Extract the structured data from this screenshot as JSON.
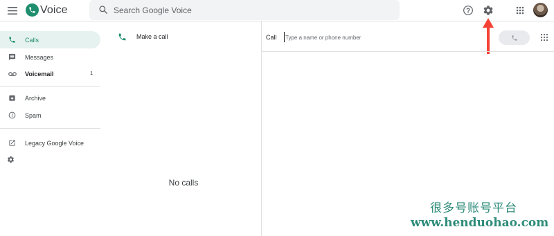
{
  "header": {
    "app_title": "Voice",
    "search_placeholder": "Search Google Voice",
    "icons": [
      "menu-icon",
      "voice-logo-icon",
      "search-icon",
      "help-icon",
      "settings-icon",
      "apps-grid-icon",
      "avatar"
    ]
  },
  "sidebar": {
    "items": [
      {
        "label": "Calls",
        "icon": "phone-icon",
        "active": true
      },
      {
        "label": "Messages",
        "icon": "message-icon"
      },
      {
        "label": "Voicemail",
        "icon": "voicemail-icon",
        "count": "1",
        "bold": true
      },
      {
        "label": "Archive",
        "icon": "archive-icon"
      },
      {
        "label": "Spam",
        "icon": "spam-icon"
      },
      {
        "label": "Legacy Google Voice",
        "icon": "open-external-icon"
      }
    ]
  },
  "list_panel": {
    "make_call_label": "Make a call",
    "empty_state": "No calls"
  },
  "dialer": {
    "call_label": "Call",
    "input_placeholder": "Type a name or phone number"
  },
  "watermark": {
    "cn_text": "很多号账号平台",
    "url": "www.henduohao.com"
  },
  "colors": {
    "brand": "#1e8e6e",
    "active_bg": "#e6f2ef",
    "annotation_arrow": "#f44336",
    "watermark": "#2e8b7a"
  }
}
